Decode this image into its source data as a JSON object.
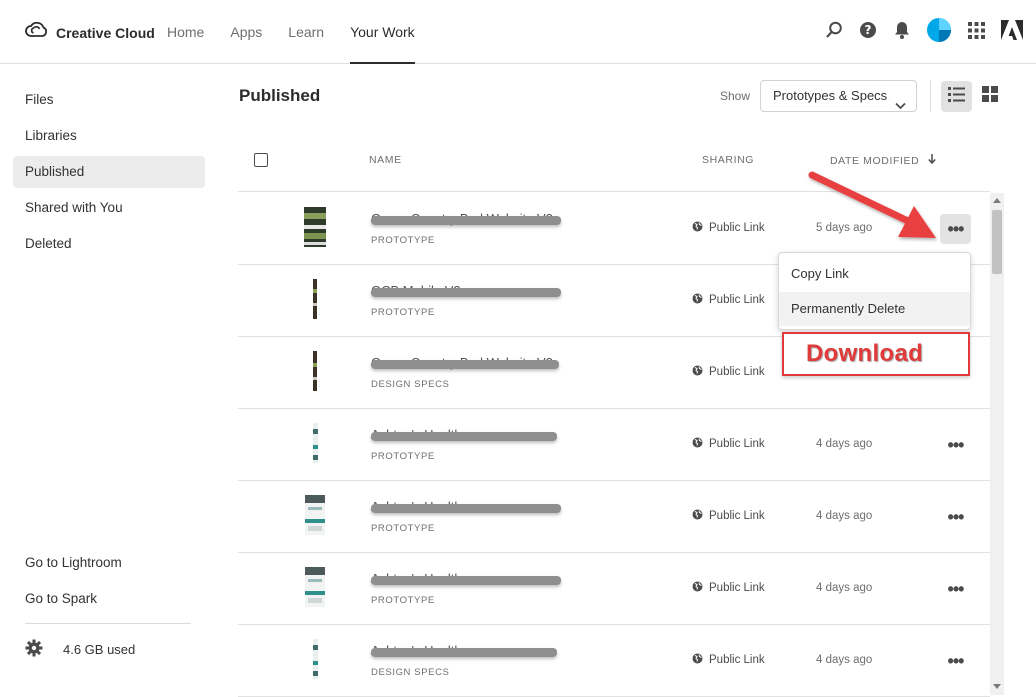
{
  "brand": {
    "name": "Creative Cloud"
  },
  "nav": {
    "items": [
      "Home",
      "Apps",
      "Learn",
      "Your Work"
    ],
    "active": "Your Work"
  },
  "sidebar": {
    "items": [
      "Files",
      "Libraries",
      "Published",
      "Shared with You",
      "Deleted"
    ],
    "active": "Published",
    "bottom_links": [
      "Go to Lightroom",
      "Go to Spark"
    ],
    "storage": "4.6 GB used"
  },
  "main": {
    "title": "Published",
    "show_label": "Show",
    "filter_value": "Prototypes & Specs",
    "view_modes": [
      "list-view",
      "grid-view"
    ],
    "active_view": "list-view"
  },
  "table": {
    "columns": {
      "name": "NAME",
      "sharing": "SHARING",
      "date": "DATE MODIFIED"
    },
    "rows": [
      {
        "name": "Green Country Bud Website V2",
        "type": "PROTOTYPE",
        "sharing": "Public Link",
        "date": "5 days ago"
      },
      {
        "name": "GCB Mobile V2",
        "type": "PROTOTYPE",
        "sharing": "Public Link",
        "date": ""
      },
      {
        "name": "Green Country Bud Website V2",
        "type": "DESIGN SPECS",
        "sharing": "Public Link",
        "date": ""
      },
      {
        "name": "Ashton's Health",
        "type": "PROTOTYPE",
        "sharing": "Public Link",
        "date": "4 days ago"
      },
      {
        "name": "Ashton's Health",
        "type": "PROTOTYPE",
        "sharing": "Public Link",
        "date": "4 days ago"
      },
      {
        "name": "Ashton's Health",
        "type": "PROTOTYPE",
        "sharing": "Public Link",
        "date": "4 days ago"
      },
      {
        "name": "Ashton's Health",
        "type": "DESIGN SPECS",
        "sharing": "Public Link",
        "date": "4 days ago"
      }
    ]
  },
  "context_menu": {
    "items": [
      "Copy Link",
      "Permanently Delete"
    ],
    "highlighted": "Permanently Delete"
  },
  "annotation": {
    "text": "Download",
    "color": "#e03a3a"
  },
  "colors": {
    "accent_avatar": "#00a8e8",
    "annotation_red": "#e03a3a"
  }
}
